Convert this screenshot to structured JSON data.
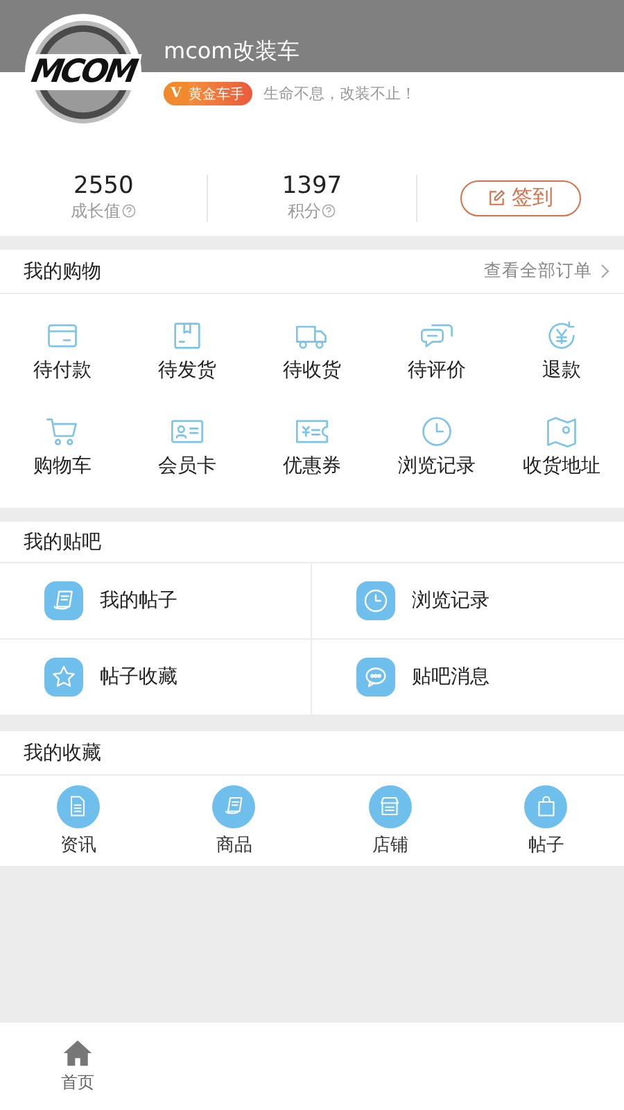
{
  "profile": {
    "logo_text": "MCOM",
    "name": "mcom改装车",
    "badge": {
      "mark": "V",
      "label": "黄金车手"
    },
    "motto": "生命不息，改装不止！"
  },
  "stats": [
    {
      "value": "2550",
      "label": "成长值"
    },
    {
      "value": "1397",
      "label": "积分"
    }
  ],
  "checkin_button": "签到",
  "shopping": {
    "title": "我的购物",
    "link": "查看全部订单",
    "items": [
      {
        "label": "待付款"
      },
      {
        "label": "待发货"
      },
      {
        "label": "待收货"
      },
      {
        "label": "待评价"
      },
      {
        "label": "退款"
      },
      {
        "label": "购物车"
      },
      {
        "label": "会员卡"
      },
      {
        "label": "优惠券"
      },
      {
        "label": "浏览记录"
      },
      {
        "label": "收货地址"
      }
    ]
  },
  "forum": {
    "title": "我的贴吧",
    "items": [
      {
        "label": "我的帖子"
      },
      {
        "label": "浏览记录"
      },
      {
        "label": "帖子收藏"
      },
      {
        "label": "贴吧消息"
      }
    ]
  },
  "favorites": {
    "title": "我的收藏",
    "items": [
      {
        "label": "资讯"
      },
      {
        "label": "商品"
      },
      {
        "label": "店铺"
      },
      {
        "label": "帖子"
      }
    ]
  },
  "tab_bar": [
    {
      "label": "首页"
    }
  ]
}
